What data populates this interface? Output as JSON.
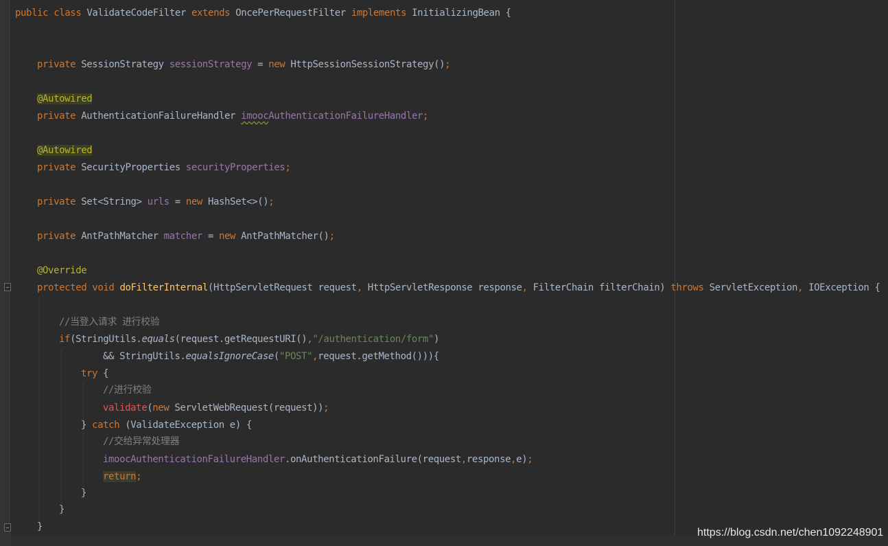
{
  "colors": {
    "background": "#2b2b2b",
    "keyword": "#cc7832",
    "field": "#9876aa",
    "annotation": "#bbb529",
    "string": "#6a8759",
    "comment": "#808080",
    "method_decl": "#ffc66d",
    "text": "#a9b7c6",
    "unresolved_call": "#e25454"
  },
  "code": {
    "l1": {
      "kw_public": "public",
      "kw_class": "class",
      "name": "ValidateCodeFilter",
      "kw_extends": "extends",
      "superclass": "OncePerRequestFilter",
      "kw_implements": "implements",
      "interface": "InitializingBean",
      "brace": "{"
    },
    "l2": {
      "kw_private": "private",
      "type": "SessionStrategy",
      "field": "sessionStrategy",
      "eq": "=",
      "kw_new": "new",
      "ctor": "HttpSessionSessionStrategy()",
      "semi": ";"
    },
    "l3": {
      "ann": "@Autowired"
    },
    "l4": {
      "kw_private": "private",
      "type": "AuthenticationFailureHandler",
      "field_prefix": "imooc",
      "field_rest": "AuthenticationFailureHandler",
      "semi": ";"
    },
    "l5": {
      "ann": "@Autowired"
    },
    "l6": {
      "kw_private": "private",
      "type": "SecurityProperties",
      "field": "securityProperties",
      "semi": ";"
    },
    "l7": {
      "kw_private": "private",
      "type": "Set<String>",
      "field": "urls",
      "eq": "=",
      "kw_new": "new",
      "ctor": "HashSet<>()",
      "semi": ";"
    },
    "l8": {
      "kw_private": "private",
      "type": "AntPathMatcher",
      "field": "matcher",
      "eq": "=",
      "kw_new": "new",
      "ctor": "AntPathMatcher()",
      "semi": ";"
    },
    "l9": {
      "ann": "@Override"
    },
    "l10": {
      "kw_protected": "protected",
      "kw_void": "void",
      "method": "doFilterInternal",
      "p1": "(HttpServletRequest request",
      "c1": ",",
      "p2": " HttpServletResponse response",
      "c2": ",",
      "p3": " FilterChain filterChain) ",
      "kw_throws": "throws",
      "ex1": " ServletException",
      "c3": ",",
      "ex2": " IOException {"
    },
    "l11": {
      "comment": "//当登入请求 进行校验"
    },
    "l12": {
      "kw_if": "if",
      "a": "(StringUtils.",
      "m": "equals",
      "b": "(request.getRequestURI()",
      "c": ",",
      "s": "\"/authentication/form\"",
      "d": ")"
    },
    "l13": {
      "a": "&& StringUtils.",
      "m": "equalsIgnoreCase",
      "b": "(",
      "s": "\"POST\"",
      "c": ",",
      "d": "request.getMethod())){"
    },
    "l14": {
      "kw_try": "try",
      "brace": " {"
    },
    "l15": {
      "comment": "//进行校验"
    },
    "l16": {
      "call": "validate",
      "a": "(",
      "kw_new": "new",
      "b": " ServletWebRequest(request))",
      "semi": ";"
    },
    "l17": {
      "a": "} ",
      "kw_catch": "catch",
      "b": " (ValidateException e) {"
    },
    "l18": {
      "comment": "//交给异常处理器"
    },
    "l19": {
      "field": "imoocAuthenticationFailureHandler",
      "a": ".onAuthenticationFailure(request",
      "c1": ",",
      "b": "response",
      "c2": ",",
      "d": "e)",
      "semi": ";"
    },
    "l20": {
      "kw_return": "return",
      "semi": ";"
    },
    "l21": {
      "brace": "}"
    },
    "l22": {
      "brace": "}"
    },
    "l23": {
      "brace": "}"
    }
  },
  "watermark": "https://blog.csdn.net/chen1092248901"
}
